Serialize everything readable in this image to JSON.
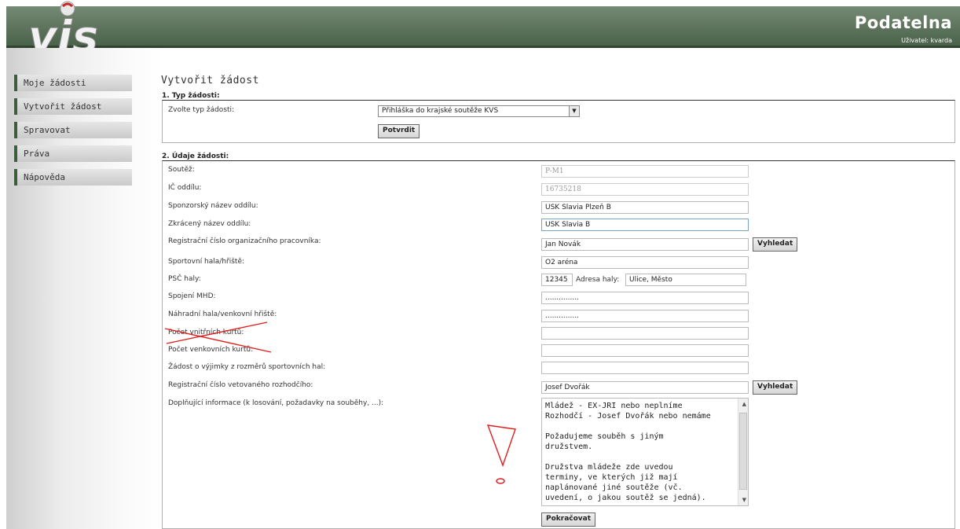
{
  "header": {
    "title": "Podatelna",
    "user_line": "Uživatel: kvarda",
    "logo_text": "vis"
  },
  "sidebar": {
    "items": [
      {
        "label": "Moje žádosti"
      },
      {
        "label": "Vytvořit žádost"
      },
      {
        "label": "Spravovat"
      },
      {
        "label": "Práva"
      },
      {
        "label": "Nápověda"
      }
    ]
  },
  "main": {
    "heading": "Vytvořit žádost",
    "section1": {
      "title": "1. Typ žádosti:",
      "type_label": "Zvolte typ žádosti:",
      "type_value": "Přihláška do krajské soutěže KVS",
      "confirm_button": "Potvrdit"
    },
    "section2": {
      "title": "2. Údaje žádosti:",
      "rows": [
        {
          "label": "Soutěž:",
          "value": "P-M1"
        },
        {
          "label": "IČ oddílu:",
          "value": "16735218"
        },
        {
          "label": "Sponzorský název oddílu:",
          "value": "USK Slavia Plzeň B"
        },
        {
          "label": "Zkrácený název oddílu:",
          "value": "USK Slavia B"
        },
        {
          "label": "Registrační číslo organizačního pracovníka:",
          "value": "Jan Novák"
        },
        {
          "label": "Sportovní hala/hřiště:",
          "value": "O2 aréna"
        },
        {
          "label": "PSČ haly:",
          "value": "12345"
        },
        {
          "label": "Spojení MHD:",
          "value": "..............."
        },
        {
          "label": "Náhradní hala/venkovní hřiště:",
          "value": "..............."
        },
        {
          "label": "Počet vnitřních kurtů:",
          "value": ""
        },
        {
          "label": "Počet venkovních kurtů:",
          "value": ""
        },
        {
          "label": "Žádost o výjimky z rozměrů sportovních hal:",
          "value": ""
        },
        {
          "label": "Registrační číslo vetovaného rozhodčího:",
          "value": "Josef Dvořák"
        },
        {
          "label": "Doplňující informace (k losování, požadavky na souběhy, ...):",
          "value": ""
        }
      ],
      "address_label": "Adresa haly:",
      "address_value": "Ulice, Město",
      "search_button": "Vyhledat",
      "textarea_value": "Mládež - EX-JRI nebo neplníme\nRozhodčí - Josef Dvořák nebo nemáme\n\nPožadujeme souběh s jiným\ndružstvem.\n\nDružstva mládeže zde uvedou\nterminy, ve kterých již mají\nnaplánované jiné soutěže (vč.\nuvedení, o jakou soutěž se jedná).",
      "continue_button": "Pokračovat"
    }
  },
  "colors": {
    "header": "#5d735c",
    "nav_accent": "#3d5e3d",
    "annotation": "#e01e1e"
  }
}
